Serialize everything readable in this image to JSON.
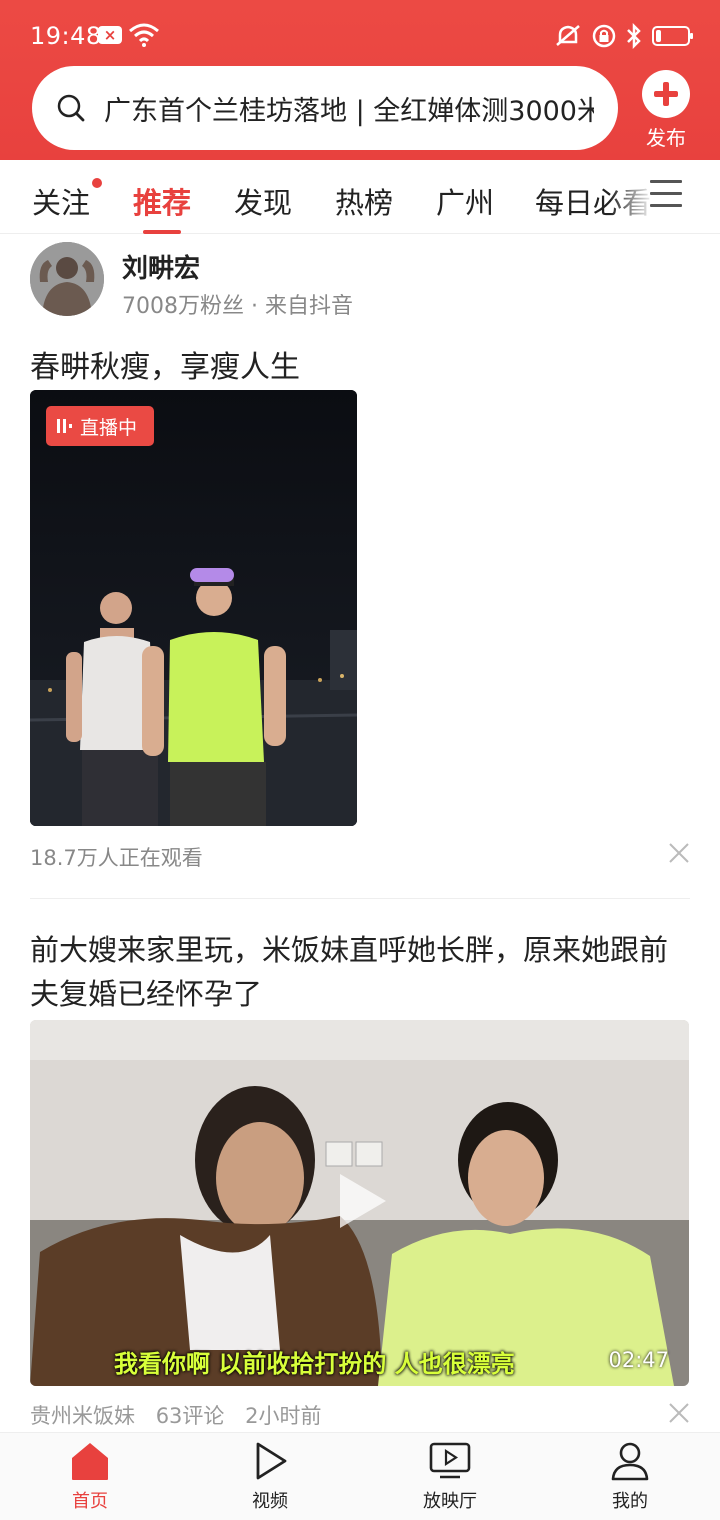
{
  "status_bar": {
    "time": "19:48",
    "icons": [
      "sim-x-icon",
      "wifi-icon",
      "mute-icon",
      "lock-icon",
      "bluetooth-icon",
      "battery-icon"
    ]
  },
  "search": {
    "text": "广东首个兰桂坊落地 | 全红婵体测3000米"
  },
  "publish": {
    "label": "发布"
  },
  "tabs": [
    {
      "label": "关注",
      "has_dot": true
    },
    {
      "label": "推荐",
      "active": true
    },
    {
      "label": "发现"
    },
    {
      "label": "热榜"
    },
    {
      "label": "广州"
    },
    {
      "label": "每日必看"
    }
  ],
  "post1": {
    "author": "刘畊宏",
    "meta": "7008万粉丝 · 来自抖音",
    "title": "春畊秋瘦，享瘦人生",
    "live_label": "直播中",
    "viewers": "18.7万人正在观看"
  },
  "post2": {
    "title": "前大嫂来家里玩，米饭妹直呼她长胖，原来她跟前夫复婚已经怀孕了",
    "subtitle": "我看你啊 以前收拾打扮的 人也很漂亮",
    "duration": "02:47",
    "source": "贵州米饭妹",
    "comments": "63评论",
    "time_ago": "2小时前"
  },
  "bottom_nav": [
    {
      "label": "首页",
      "icon": "home-icon",
      "active": true
    },
    {
      "label": "视频",
      "icon": "play-icon"
    },
    {
      "label": "放映厅",
      "icon": "tv-icon"
    },
    {
      "label": "我的",
      "icon": "person-icon"
    }
  ],
  "colors": {
    "brand_red": "#e8413e",
    "subtitle_green": "#d8ff3a"
  }
}
